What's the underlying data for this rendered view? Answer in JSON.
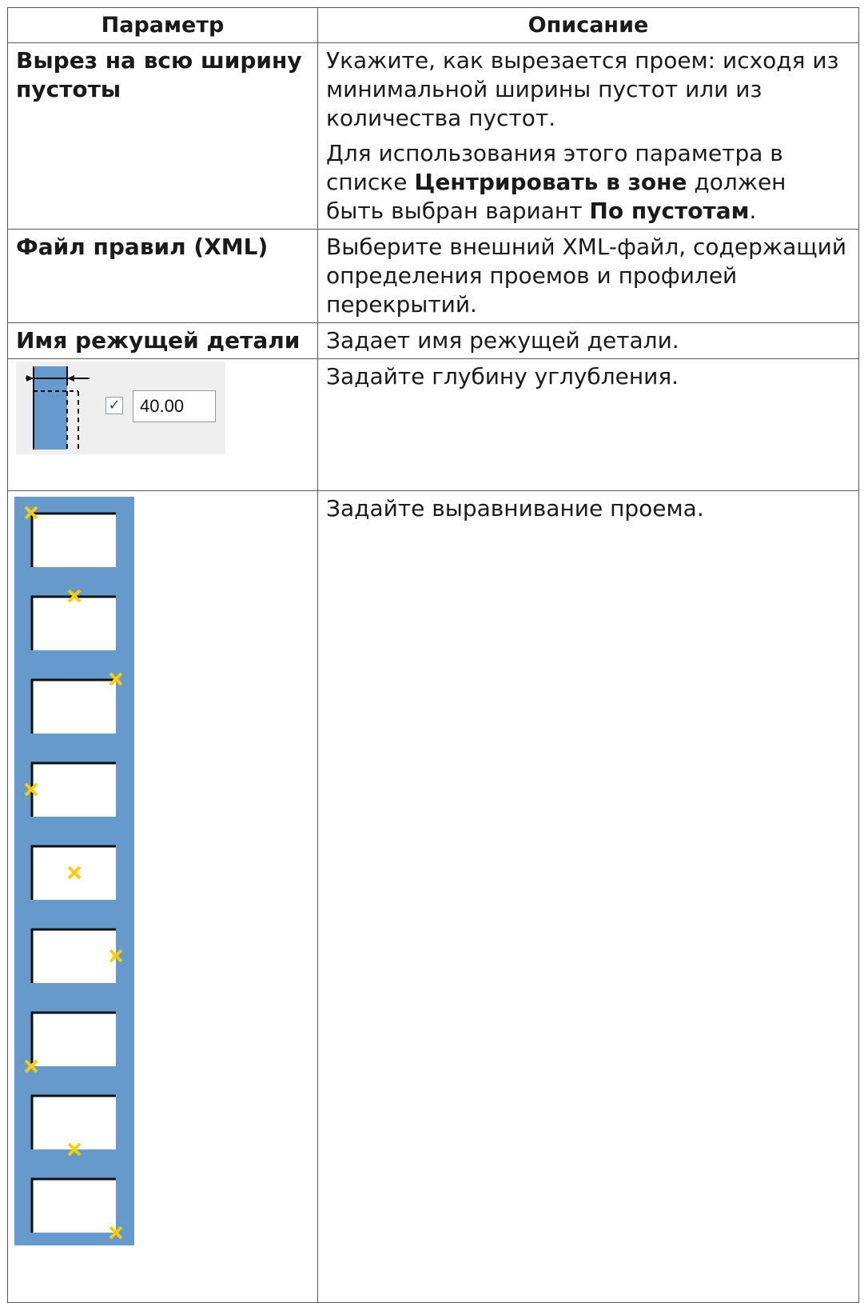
{
  "table": {
    "headers": [
      "Параметр",
      "Описание"
    ],
    "rows": [
      {
        "param": "Вырез на всю ширину пустоты",
        "desc1": "Укажите, как вырезается проем: исходя из минимальной ширины пустот или из количества пустот.",
        "desc2_pre": "Для использования этого параметра в списке ",
        "desc2_bold1": "Центрировать в зоне",
        "desc2_mid": " должен быть выбран вариант ",
        "desc2_bold2": "По пустотам",
        "desc2_post": "."
      },
      {
        "param": "Файл правил (XML)",
        "desc": "Выберите внешний XML-файл, содержащий определения проемов и профилей перекрытий."
      },
      {
        "param": "Имя режущей детали",
        "desc": "Задает имя режущей детали."
      },
      {
        "depth_checkbox": "✓",
        "depth_value": "40.00",
        "desc": "Задайте глубину углубления."
      },
      {
        "alignment_options": [
          "top-left",
          "top-center",
          "top-right",
          "middle-left",
          "middle-center",
          "middle-right",
          "bottom-left",
          "bottom-center",
          "bottom-right"
        ],
        "desc": "Задайте выравнивание проема."
      }
    ]
  },
  "colors": {
    "icon_blue": "#6699cc",
    "marker_yellow": "#ffcc00",
    "border": "#595959"
  },
  "icons": [
    "depth-icon",
    "alignment-icon"
  ]
}
